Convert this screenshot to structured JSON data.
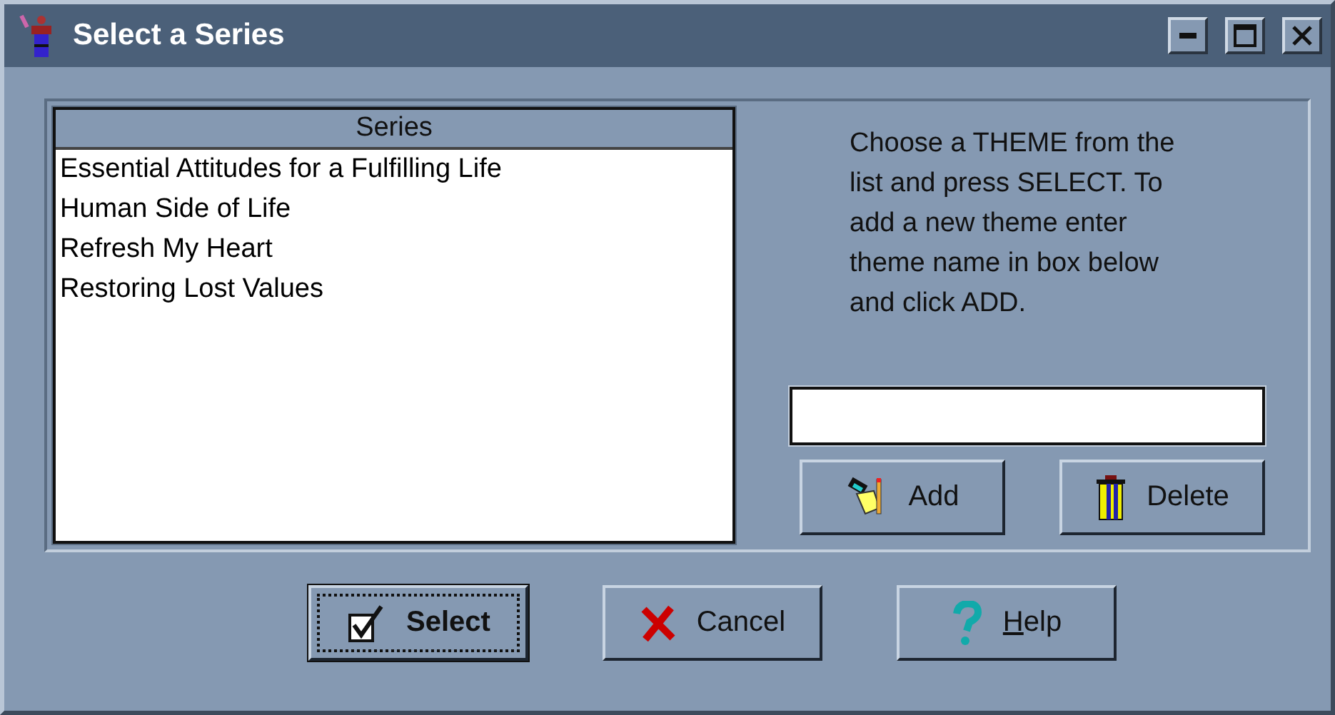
{
  "window": {
    "title": "Select a Series"
  },
  "series_list": {
    "header": "Series",
    "items": [
      {
        "label": "Essential Attitudes for a Fulfilling Life",
        "selected": false
      },
      {
        "label": "Human Side of Life",
        "selected": false
      },
      {
        "label": "Refresh My Heart",
        "selected": false
      },
      {
        "label": "Restoring Lost Values",
        "selected": false
      }
    ]
  },
  "instructions": "Choose a THEME from the list and press SELECT. To add a new theme enter theme name in box below and click ADD.",
  "list_buttons": [
    {
      "kind": "add",
      "label": "Add"
    },
    {
      "kind": "delete",
      "label": "Delete"
    }
  ],
  "dialog_buttons": [
    {
      "kind": "select",
      "label": "Select",
      "default": true,
      "underline_first": false
    },
    {
      "kind": "cancel",
      "label": "Cancel",
      "default": false,
      "underline_first": false
    },
    {
      "kind": "help",
      "label": "Help",
      "default": false,
      "underline_first": true
    }
  ]
}
